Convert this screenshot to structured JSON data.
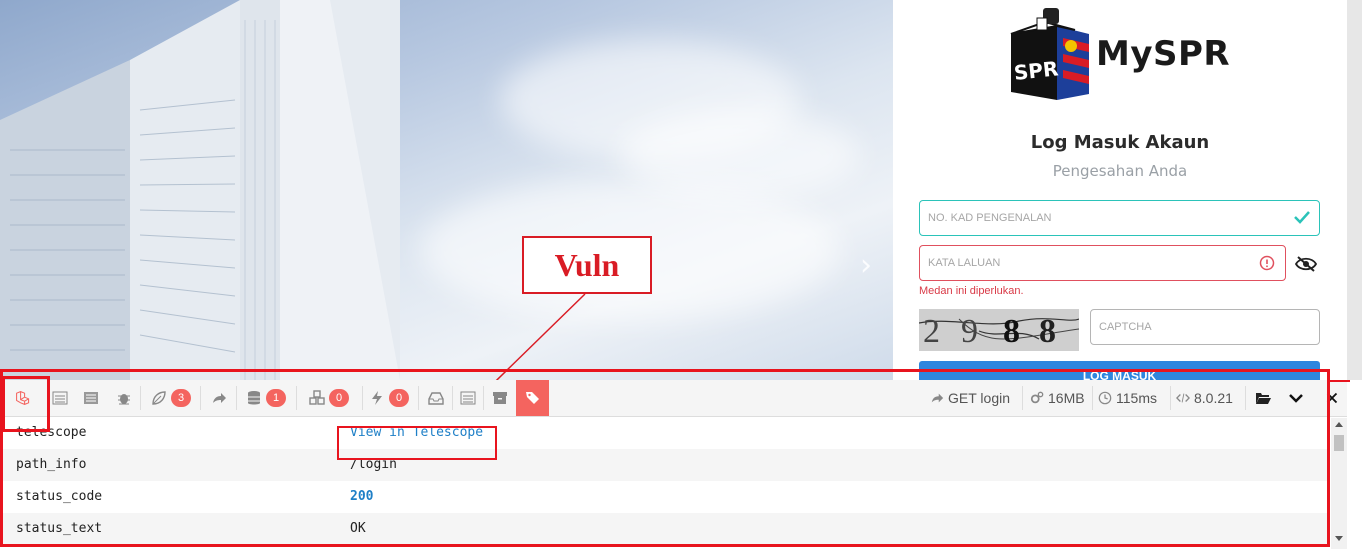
{
  "brand": {
    "name": "MySPR",
    "logo_text": "SPR"
  },
  "login": {
    "title": "Log Masuk Akaun",
    "subtitle": "Pengesahan Anda",
    "ic_placeholder": "NO. KAD PENGENALAN",
    "password_placeholder": "KATA LALUAN",
    "password_error": "Medan ini diperlukan.",
    "captcha_digits": [
      "2",
      "9",
      "8",
      "8"
    ],
    "captcha_placeholder": "CAPTCHA",
    "submit_label": "LOG MASUK"
  },
  "annotation": {
    "label": "Vuln"
  },
  "debugbar": {
    "badges": {
      "messages": "3",
      "queries": "1",
      "models": "0",
      "events": "0"
    },
    "request": "GET login",
    "memory": "16MB",
    "time": "115ms",
    "php_version": "8.0.21",
    "rows": [
      {
        "key": "telescope",
        "value": "View in Telescope"
      },
      {
        "key": "path_info",
        "value": "/login"
      },
      {
        "key": "status_code",
        "value": "200"
      },
      {
        "key": "status_text",
        "value": "OK"
      }
    ]
  },
  "colors": {
    "accent_red": "#e8141e",
    "badge": "#f4645f",
    "link": "#1e7fc7",
    "valid": "#2bc3b9",
    "error": "#d93a47"
  }
}
